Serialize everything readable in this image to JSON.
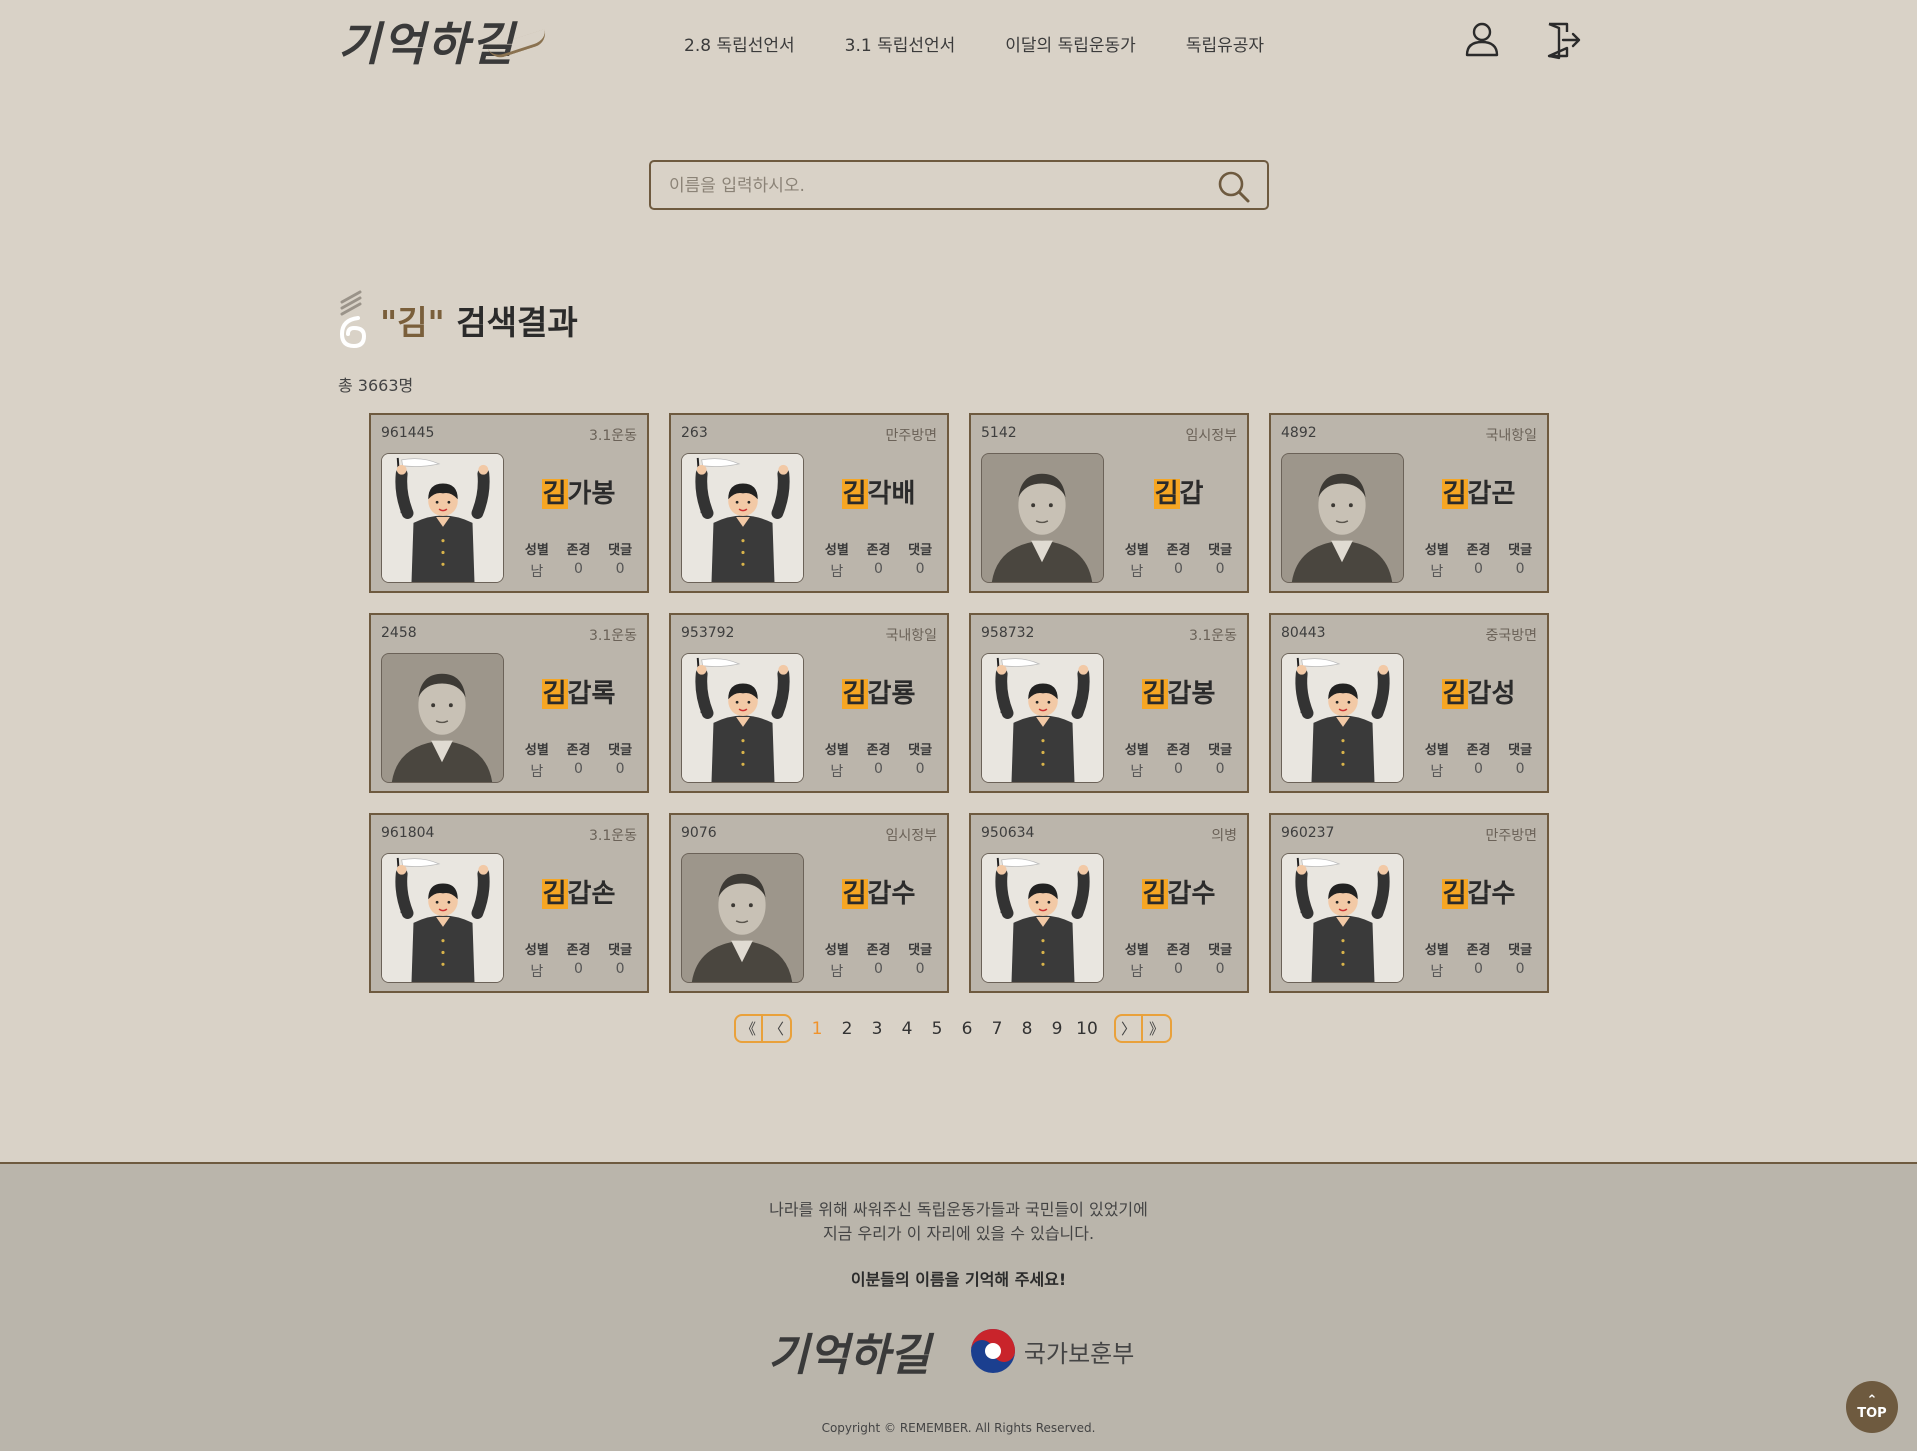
{
  "header": {
    "logo_text": "기억하길",
    "nav": [
      "2.8 독립선언서",
      "3.1 독립선언서",
      "이달의 독립운동가",
      "독립유공자"
    ]
  },
  "search": {
    "placeholder": "이름을 입력하시오.",
    "value": ""
  },
  "results": {
    "query_display": "\"김\"",
    "title_suffix": " 검색결과",
    "total": "총 3663명",
    "stat_labels": [
      "성별",
      "존경",
      "댓글"
    ],
    "highlight": "김",
    "cards": [
      {
        "id": "961445",
        "category": "3.1운동",
        "surname": "김",
        "rest": "가봉",
        "photo": "illustration",
        "gender": "남",
        "respect": "0",
        "comments": "0"
      },
      {
        "id": "263",
        "category": "만주방면",
        "surname": "김",
        "rest": "각배",
        "photo": "illustration",
        "gender": "남",
        "respect": "0",
        "comments": "0"
      },
      {
        "id": "5142",
        "category": "임시정부",
        "surname": "김",
        "rest": "갑",
        "photo": "portrait",
        "gender": "남",
        "respect": "0",
        "comments": "0"
      },
      {
        "id": "4892",
        "category": "국내항일",
        "surname": "김",
        "rest": "갑곤",
        "photo": "portrait",
        "gender": "남",
        "respect": "0",
        "comments": "0"
      },
      {
        "id": "2458",
        "category": "3.1운동",
        "surname": "김",
        "rest": "갑록",
        "photo": "portrait",
        "gender": "남",
        "respect": "0",
        "comments": "0"
      },
      {
        "id": "953792",
        "category": "국내항일",
        "surname": "김",
        "rest": "갑룡",
        "photo": "illustration",
        "gender": "남",
        "respect": "0",
        "comments": "0"
      },
      {
        "id": "958732",
        "category": "3.1운동",
        "surname": "김",
        "rest": "갑봉",
        "photo": "illustration",
        "gender": "남",
        "respect": "0",
        "comments": "0"
      },
      {
        "id": "80443",
        "category": "중국방면",
        "surname": "김",
        "rest": "갑성",
        "photo": "illustration",
        "gender": "남",
        "respect": "0",
        "comments": "0"
      },
      {
        "id": "961804",
        "category": "3.1운동",
        "surname": "김",
        "rest": "갑손",
        "photo": "illustration",
        "gender": "남",
        "respect": "0",
        "comments": "0"
      },
      {
        "id": "9076",
        "category": "임시정부",
        "surname": "김",
        "rest": "갑수",
        "photo": "portrait",
        "gender": "남",
        "respect": "0",
        "comments": "0"
      },
      {
        "id": "950634",
        "category": "의병",
        "surname": "김",
        "rest": "갑수",
        "photo": "illustration",
        "gender": "남",
        "respect": "0",
        "comments": "0"
      },
      {
        "id": "960237",
        "category": "만주방면",
        "surname": "김",
        "rest": "갑수",
        "photo": "illustration",
        "gender": "남",
        "respect": "0",
        "comments": "0"
      }
    ]
  },
  "pagination": {
    "first": "《",
    "prev": "〈",
    "next": "〉",
    "last": "》",
    "pages": [
      "1",
      "2",
      "3",
      "4",
      "5",
      "6",
      "7",
      "8",
      "9",
      "10"
    ],
    "current": "1"
  },
  "footer": {
    "line1": "나라를 위해 싸워주신 독립운동가들과 국민들이 있었기에",
    "line2": "지금 우리가 이 자리에 있을 수 있습니다.",
    "line3": "이분들의 이름을 기억해 주세요!",
    "logo_text": "기억하길",
    "gov_name": "국가보훈부",
    "copyright": "Copyright © REMEMBER. All Rights Reserved."
  },
  "top_button": {
    "arrow": "⌃",
    "label": "TOP"
  },
  "colors": {
    "background": "#d9d2c7",
    "card": "#bbb5ab",
    "border": "#6e5a3f",
    "highlight": "#f6a623",
    "active_page": "#f0932b"
  }
}
